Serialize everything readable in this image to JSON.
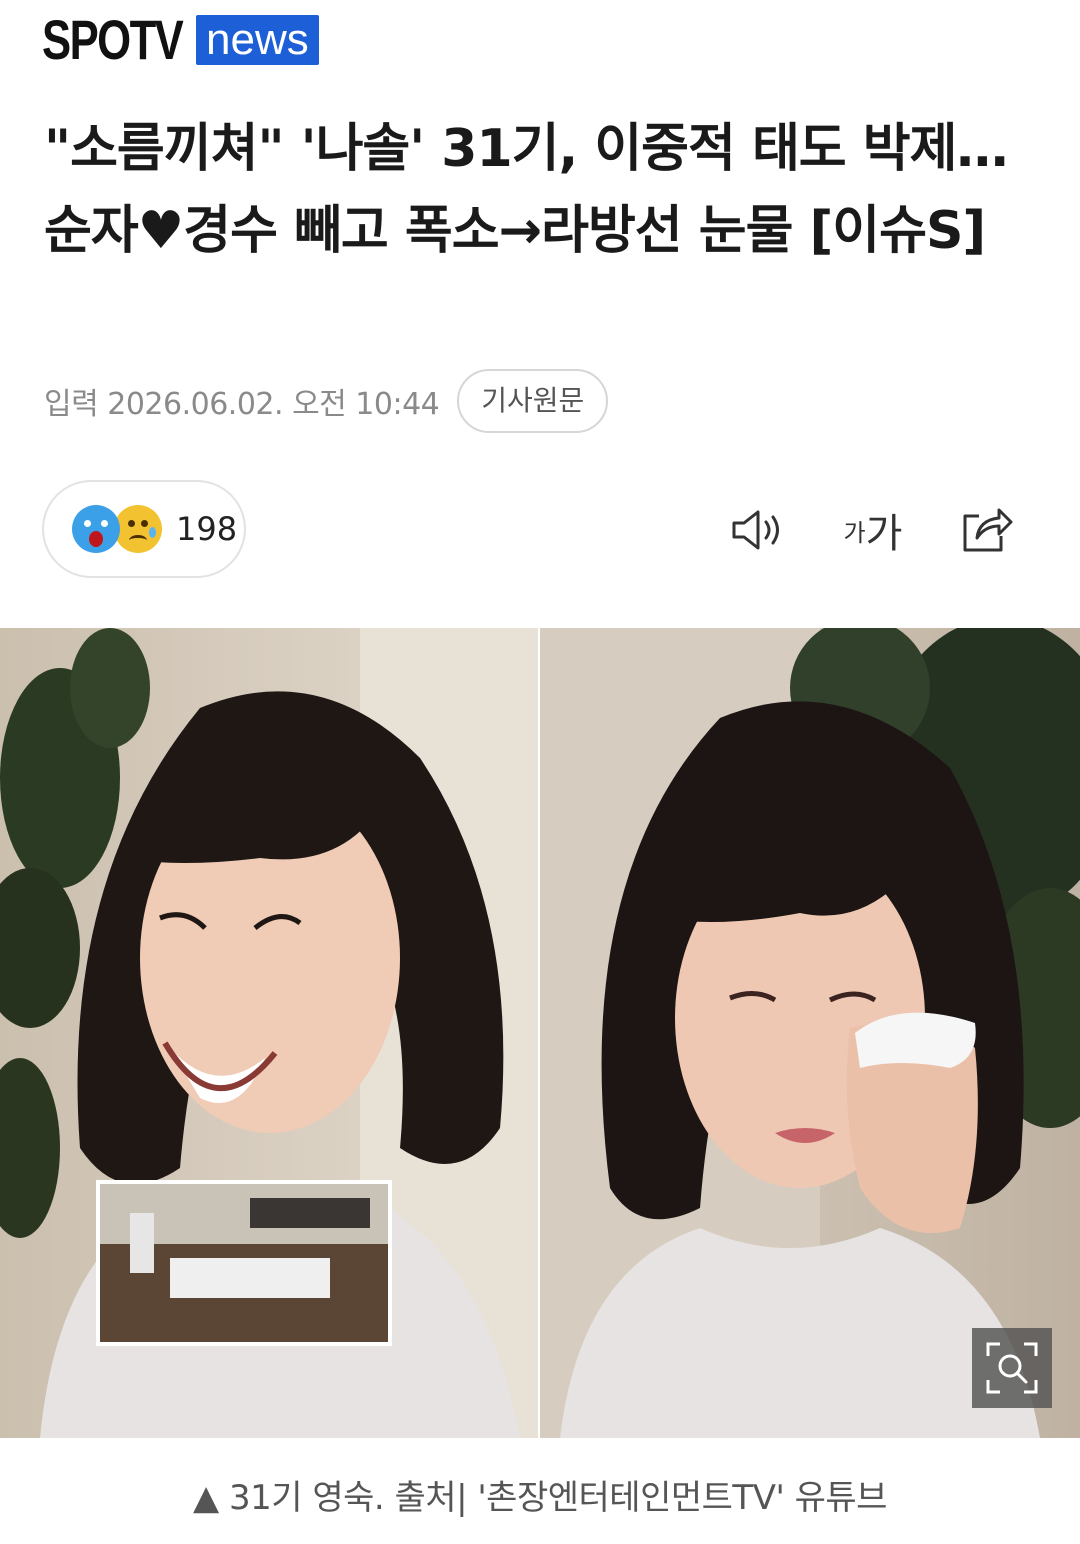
{
  "header": {
    "logo_primary": "SPOTV",
    "logo_secondary": "news"
  },
  "article": {
    "headline": "\"소름끼쳐\" '나솔' 31기, 이중적 태도 박제…순자♥경수 빼고 폭소→라방선 눈물 [이슈S]",
    "published": "입력 2026.06.02. 오전 10:44",
    "original_link_label": "기사원문"
  },
  "reactions": {
    "icons": [
      "surprised-emoji",
      "sad-emoji"
    ],
    "count": "198"
  },
  "toolbar": {
    "speaker_icon": "speaker-icon",
    "font_size_label_small": "가",
    "font_size_label_large": "가",
    "share_icon": "share-icon"
  },
  "photo": {
    "zoom_icon": "zoom-icon",
    "caption": "▲ 31기 영숙. 출처| '촌장엔터테인먼트TV' 유튜브"
  },
  "colors": {
    "news_badge": "#1d5fd6",
    "meta_text": "#8a8a8a",
    "border": "#e2e2e2"
  }
}
